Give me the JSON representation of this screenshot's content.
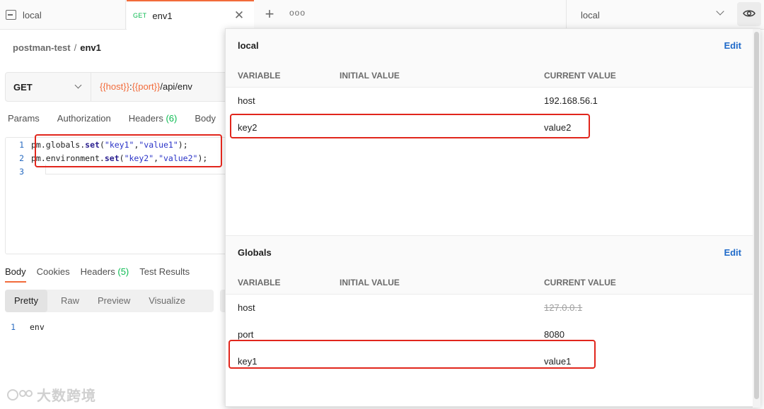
{
  "tabs": [
    {
      "label": "local"
    },
    {
      "method": "GET",
      "label": "env1"
    }
  ],
  "tab_actions": {
    "close_glyph": "✕",
    "new_glyph": "+",
    "more_glyph": "ooo"
  },
  "env_selector": {
    "value": "local"
  },
  "breadcrumb": {
    "collection": "postman-test",
    "separator": "/",
    "request": "env1"
  },
  "request": {
    "method": "GET",
    "url_parts": {
      "host_var": "{{host}}",
      "colon": ":",
      "port_var": "{{port}}",
      "path": "/api/env"
    }
  },
  "request_tabs": [
    {
      "label": "Params"
    },
    {
      "label": "Authorization"
    },
    {
      "label": "Headers",
      "count": "(6)"
    },
    {
      "label": "Body"
    }
  ],
  "editor": {
    "lines": [
      {
        "num": "1",
        "obj": "pm.globals.",
        "fn": "set",
        "open": "(",
        "arg1": "\"key1\"",
        "comma": ",",
        "arg2": "\"value1\"",
        "close": ");"
      },
      {
        "num": "2",
        "obj": "pm.environment.",
        "fn": "set",
        "open": "(",
        "arg1": "\"key2\"",
        "comma": ",",
        "arg2": "\"value2\"",
        "close": ");"
      },
      {
        "num": "3"
      }
    ]
  },
  "response_tabs": [
    {
      "label": "Body"
    },
    {
      "label": "Cookies"
    },
    {
      "label": "Headers",
      "count": "(5)"
    },
    {
      "label": "Test Results"
    }
  ],
  "view_modes": [
    {
      "label": "Pretty"
    },
    {
      "label": "Raw"
    },
    {
      "label": "Preview"
    },
    {
      "label": "Visualize"
    }
  ],
  "response_body": {
    "num": "1",
    "text": "env"
  },
  "watermark": {
    "text": "大数跨境"
  },
  "environment_panel": {
    "sections": [
      {
        "title": "local",
        "edit_label": "Edit",
        "columns": [
          "VARIABLE",
          "INITIAL VALUE",
          "CURRENT VALUE"
        ],
        "rows": [
          {
            "variable": "host",
            "initial": "",
            "current": "192.168.56.1"
          },
          {
            "variable": "key2",
            "initial": "",
            "current": "value2"
          }
        ]
      },
      {
        "title": "Globals",
        "edit_label": "Edit",
        "columns": [
          "VARIABLE",
          "INITIAL VALUE",
          "CURRENT VALUE"
        ],
        "rows": [
          {
            "variable": "host",
            "initial": "",
            "current": "127.0.0.1",
            "strikethrough": true
          },
          {
            "variable": "port",
            "initial": "",
            "current": "8080"
          },
          {
            "variable": "key1",
            "initial": "",
            "current": "value1"
          }
        ]
      }
    ]
  },
  "colors": {
    "accent": "#f26b3a",
    "count_green": "#0cbb52",
    "edit_link": "#1f6ac9",
    "highlight_red": "#e1261c"
  }
}
